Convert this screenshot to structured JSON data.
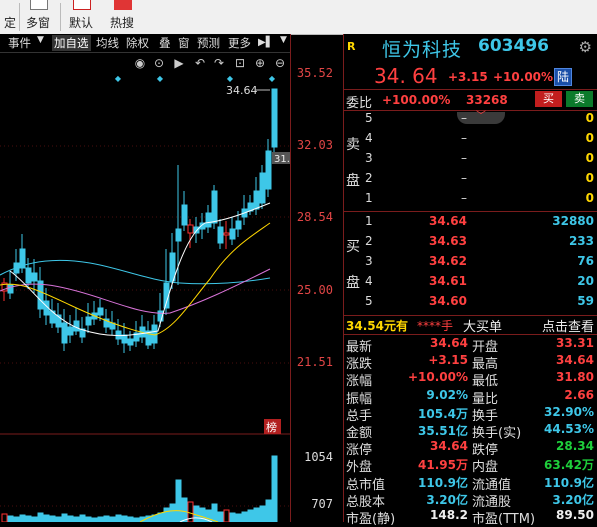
{
  "toolbar": {
    "items": [
      {
        "label": "定"
      },
      {
        "label": "多窗"
      },
      {
        "label": "默认"
      },
      {
        "label": "热搜"
      }
    ]
  },
  "tabs": {
    "items": [
      "事件",
      "加自选",
      "均线",
      "除权",
      "叠",
      "窗",
      "预测",
      "更多"
    ]
  },
  "chart": {
    "current_price_tag": "34.64",
    "right_tag": "31.",
    "rank_badge": "榜",
    "price_axis": [
      "35.52",
      "32.03",
      "28.54",
      "25.00",
      "21.51"
    ],
    "volume_axis": [
      "1054",
      "707"
    ],
    "bull_color": "#ff3030",
    "bear_color": "#3ec7e8"
  },
  "stock": {
    "market_badge": "R",
    "name": "恒为科技",
    "code": "603496",
    "price": "34. 64",
    "change": "+3.15",
    "change_pct": "+10.00%",
    "board_badge": "陆",
    "wei_label": "委比",
    "wei_pct": "+100.00%",
    "wei_val": "33268",
    "buy_btn": "买",
    "sell_btn": "卖"
  },
  "orderbook": {
    "sell_side_chars": [
      "卖",
      "盘"
    ],
    "buy_side_chars": [
      "买",
      "盘"
    ],
    "asks": [
      {
        "level": "5",
        "price": "–",
        "vol": "0"
      },
      {
        "level": "4",
        "price": "–",
        "vol": "0"
      },
      {
        "level": "3",
        "price": "–",
        "vol": "0"
      },
      {
        "level": "2",
        "price": "–",
        "vol": "0"
      },
      {
        "level": "1",
        "price": "–",
        "vol": "0"
      }
    ],
    "bids": [
      {
        "level": "1",
        "price": "34.64",
        "vol": "32880"
      },
      {
        "level": "2",
        "price": "34.63",
        "vol": "233"
      },
      {
        "level": "3",
        "price": "34.62",
        "vol": "76"
      },
      {
        "level": "4",
        "price": "34.61",
        "vol": "20"
      },
      {
        "level": "5",
        "price": "34.60",
        "vol": "59"
      }
    ]
  },
  "infobar": {
    "price_unit": "34.54元有",
    "stars": "****手",
    "big_order": "大买单",
    "link": "点击查看"
  },
  "stats": [
    {
      "l1": "最新",
      "v1": "34.64",
      "c1": "red",
      "l2": "开盘",
      "v2": "33.31",
      "c2": "red"
    },
    {
      "l1": "涨跌",
      "v1": "+3.15",
      "c1": "red",
      "l2": "最高",
      "v2": "34.64",
      "c2": "red"
    },
    {
      "l1": "涨幅",
      "v1": "+10.00%",
      "c1": "red",
      "l2": "最低",
      "v2": "31.80",
      "c2": "red"
    },
    {
      "l1": "振幅",
      "v1": "9.02%",
      "c1": "cyan",
      "l2": "量比",
      "v2": "2.66",
      "c2": "red"
    },
    {
      "l1": "总手",
      "v1": "105.4万",
      "c1": "cyan",
      "l2": "换手",
      "v2": "32.90%",
      "c2": "cyan"
    },
    {
      "l1": "金额",
      "v1": "35.51亿",
      "c1": "cyan",
      "l2": "换手(实)",
      "v2": "44.53%",
      "c2": "cyan"
    },
    {
      "l1": "涨停",
      "v1": "34.64",
      "c1": "red",
      "l2": "跌停",
      "v2": "28.34",
      "c2": "green"
    },
    {
      "l1": "外盘",
      "v1": "41.95万",
      "c1": "red",
      "l2": "内盘",
      "v2": "63.42万",
      "c2": "green"
    },
    {
      "l1": "总市值",
      "v1": "110.9亿",
      "c1": "cyan",
      "l2": "流通值",
      "v2": "110.9亿",
      "c2": "cyan"
    },
    {
      "l1": "总股本",
      "v1": "3.20亿",
      "c1": "cyan",
      "l2": "流通股",
      "v2": "3.20亿",
      "c2": "cyan"
    },
    {
      "l1": "市盈(静)",
      "v1": "148.2",
      "c1": "white",
      "l2": "市盈(TTM)",
      "v2": "89.50",
      "c2": "white"
    }
  ]
}
